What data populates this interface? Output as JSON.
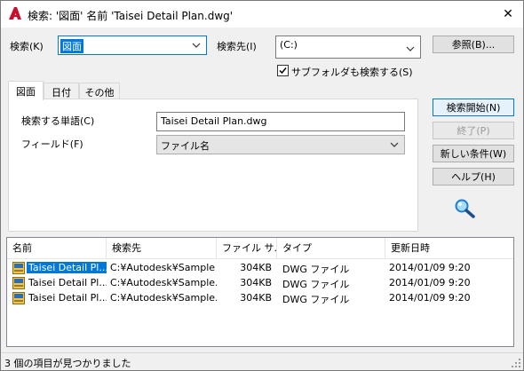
{
  "window": {
    "title": "検索: '図面' 名前 'Taisei Detail Plan.dwg'",
    "close_glyph": "✕",
    "icon": "autocad-a-icon"
  },
  "search": {
    "search_label": "検索(K)",
    "search_value": "図面",
    "location_label": "検索先(I)",
    "location_value": "(C:)",
    "browse_label": "参照(B)...",
    "subfolders_label": "サブフォルダも検索する(S)",
    "subfolders_checked": true
  },
  "tabs": [
    {
      "label": "図面"
    },
    {
      "label": "日付"
    },
    {
      "label": "その他"
    }
  ],
  "tab_panel": {
    "word_label": "検索する単語(C)",
    "word_value": "Taisei Detail Plan.dwg",
    "field_label": "フィールド(F)",
    "field_value": "ファイル名"
  },
  "actions": {
    "start": "検索開始(N)",
    "stop": "終了(P)",
    "new": "新しい条件(W)",
    "help": "ヘルプ(H)"
  },
  "results": {
    "columns": [
      "名前",
      "検索先",
      "ファイル サ...",
      "タイプ",
      "更新日時"
    ],
    "rows": [
      {
        "name": "Taisei Detail Pl...",
        "location": "C:¥Autodesk¥Sample",
        "size": "304KB",
        "type": "DWG ファイル",
        "modified": "2014/01/09 9:20",
        "selected": true
      },
      {
        "name": "Taisei Detail Pl...",
        "location": "C:¥Autodesk¥Sample...",
        "size": "304KB",
        "type": "DWG ファイル",
        "modified": "2014/01/09 9:20",
        "selected": false
      },
      {
        "name": "Taisei Detail Pl...",
        "location": "C:¥Autodesk¥Sample...",
        "size": "304KB",
        "type": "DWG ファイル",
        "modified": "2014/01/09 9:20",
        "selected": false
      }
    ]
  },
  "status": {
    "text": "3 個の項目が見つかりました"
  },
  "colors": {
    "selection": "#0078d7",
    "autocad_red": "#c8102e",
    "magnifier": "#1e7fd0"
  }
}
